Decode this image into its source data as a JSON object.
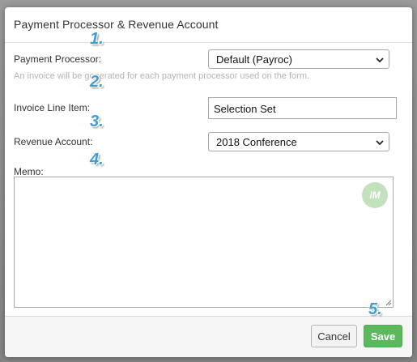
{
  "dialog": {
    "title": "Payment Processor & Revenue Account",
    "payment_processor": {
      "label": "Payment Processor:",
      "value": "Default (Payroc)",
      "hint": "An invoice will be generated for each payment processor used on the form."
    },
    "invoice_line_item": {
      "label": "Invoice Line Item:",
      "value": "Selection Set"
    },
    "revenue_account": {
      "label": "Revenue Account:",
      "value": "2018 Conference"
    },
    "memo": {
      "label": "Memo:",
      "value": "",
      "badge": "IM"
    },
    "footer": {
      "cancel_label": "Cancel",
      "save_label": "Save",
      "save_color": "#5cb85c"
    }
  },
  "annotations": [
    "1.",
    "2.",
    "3.",
    "4.",
    "5."
  ],
  "icons": [
    "chevron-down-icon",
    "resize-grip-icon"
  ]
}
